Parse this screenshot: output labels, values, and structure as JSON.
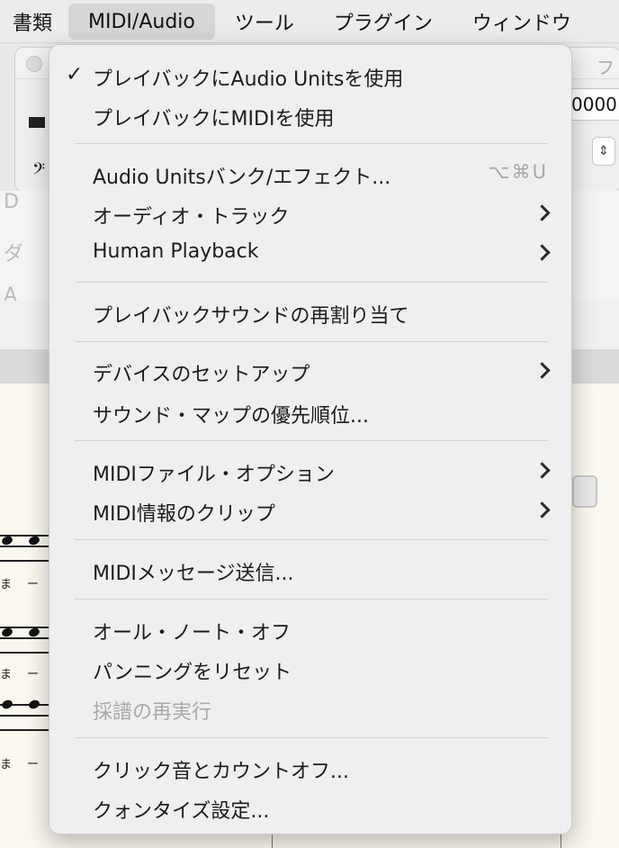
{
  "menubar": {
    "items": [
      "書類",
      "MIDI/Audio",
      "ツール",
      "プラグイン",
      "ウィンドウ"
    ]
  },
  "background": {
    "window_title_fragment": "フ",
    "number_field": "0000",
    "stepper": "⇕",
    "panel_rows": [
      "D",
      "ダ",
      "A"
    ],
    "lyrics": [
      "ま",
      "ー"
    ]
  },
  "menu": {
    "items": [
      {
        "label": "プレイバックにAudio Unitsを使用",
        "checked": true
      },
      {
        "label": "プレイバックにMIDIを使用"
      },
      {
        "label": "Audio Unitsバンク/エフェクト...",
        "shortcut": "⌥⌘U"
      },
      {
        "label": "オーディオ・トラック",
        "submenu": true
      },
      {
        "label": "Human Playback",
        "submenu": true
      },
      {
        "label": "プレイバックサウンドの再割り当て"
      },
      {
        "label": "デバイスのセットアップ",
        "submenu": true
      },
      {
        "label": "サウンド・マップの優先順位..."
      },
      {
        "label": "MIDIファイル・オプション",
        "submenu": true
      },
      {
        "label": "MIDI情報のクリップ",
        "submenu": true
      },
      {
        "label": "MIDIメッセージ送信..."
      },
      {
        "label": "オール・ノート・オフ"
      },
      {
        "label": "パンニングをリセット"
      },
      {
        "label": "採譜の再実行",
        "disabled": true
      },
      {
        "label": "クリック音とカウントオフ..."
      },
      {
        "label": "クォンタイズ設定..."
      }
    ],
    "check_glyph": "✓"
  }
}
